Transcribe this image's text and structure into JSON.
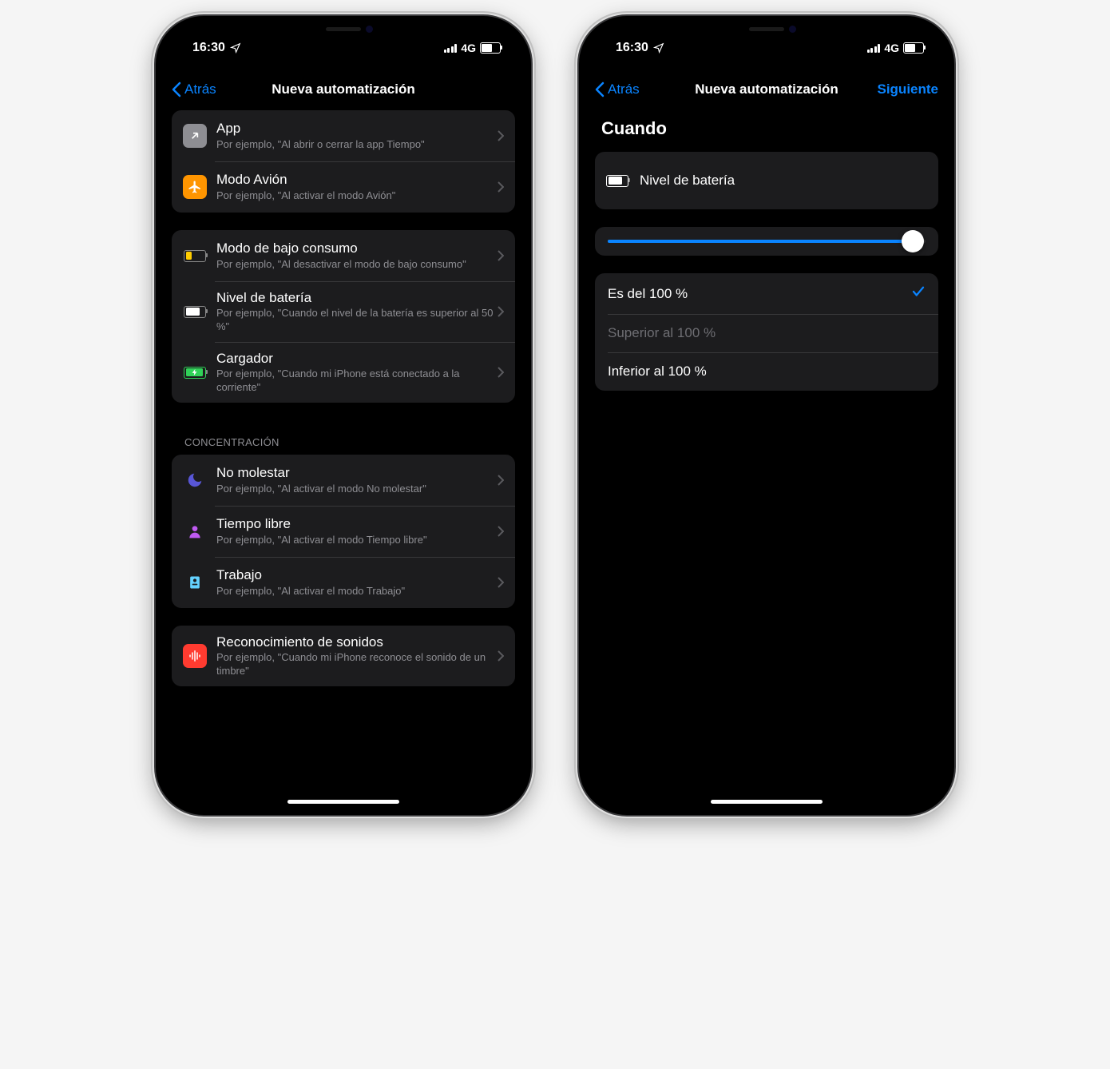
{
  "status": {
    "time": "16:30",
    "network": "4G"
  },
  "left": {
    "back": "Atrás",
    "title": "Nueva automatización",
    "groups": [
      {
        "rows": [
          {
            "title": "App",
            "sub": "Por ejemplo, \"Al abrir o cerrar la app Tiempo\""
          },
          {
            "title": "Modo Avión",
            "sub": "Por ejemplo, \"Al activar el modo Avión\""
          }
        ]
      },
      {
        "rows": [
          {
            "title": "Modo de bajo consumo",
            "sub": "Por ejemplo, \"Al desactivar el modo de bajo consumo\""
          },
          {
            "title": "Nivel de batería",
            "sub": "Por ejemplo, \"Cuando el nivel de la batería es superior al 50 %\""
          },
          {
            "title": "Cargador",
            "sub": "Por ejemplo, \"Cuando mi iPhone está conectado a la corriente\""
          }
        ]
      },
      {
        "header": "CONCENTRACIÓN",
        "rows": [
          {
            "title": "No molestar",
            "sub": "Por ejemplo, \"Al activar el modo No molestar\""
          },
          {
            "title": "Tiempo libre",
            "sub": "Por ejemplo, \"Al activar el modo Tiempo libre\""
          },
          {
            "title": "Trabajo",
            "sub": "Por ejemplo, \"Al activar el modo Trabajo\""
          }
        ]
      },
      {
        "rows": [
          {
            "title": "Reconocimiento de sonidos",
            "sub": "Por ejemplo, \"Cuando mi iPhone reconoce el sonido de un timbre\""
          }
        ]
      }
    ]
  },
  "right": {
    "back": "Atrás",
    "title": "Nueva automatización",
    "next": "Siguiente",
    "when": "Cuando",
    "trigger": "Nivel de batería",
    "slider": 100,
    "options": [
      {
        "label": "Es del 100 %",
        "state": "selected"
      },
      {
        "label": "Superior al 100 %",
        "state": "disabled"
      },
      {
        "label": "Inferior al 100 %",
        "state": "normal"
      }
    ]
  }
}
